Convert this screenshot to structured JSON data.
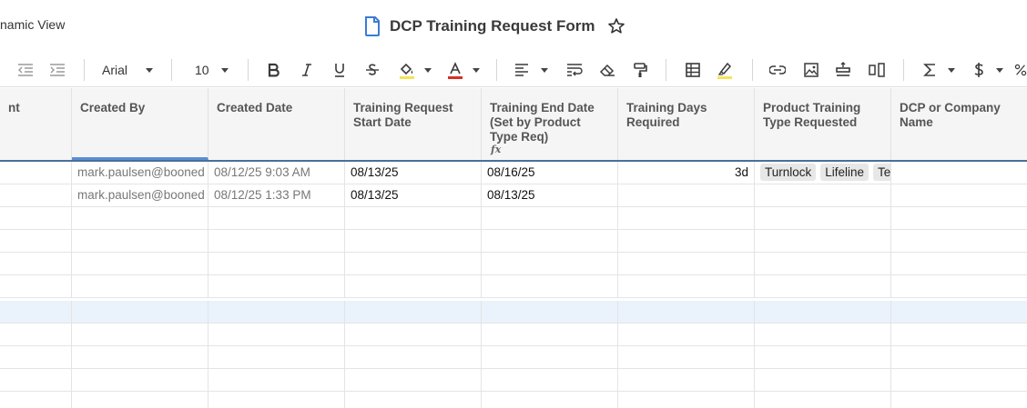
{
  "header": {
    "view_label": "namic View",
    "title": "DCP Training Request Form"
  },
  "toolbar": {
    "font_family": "Arial",
    "font_size": "10",
    "icons": [
      "outdent-icon",
      "indent-icon",
      "bold-icon",
      "italic-icon",
      "underline-icon",
      "strikethrough-icon",
      "fill-color-icon",
      "text-color-icon",
      "align-left-icon",
      "wrap-text-icon",
      "clear-format-icon",
      "paint-format-icon",
      "table-icon",
      "highlight-icon",
      "link-icon",
      "image-icon",
      "row-height-icon",
      "column-icon",
      "sum-icon",
      "currency-icon",
      "percent-icon"
    ],
    "fill_color_accent": "#f5e35a",
    "text_color_accent": "#d93025",
    "highlight_accent": "#f5e35a"
  },
  "grid": {
    "columns": [
      {
        "label": "nt"
      },
      {
        "label": "Created By"
      },
      {
        "label": "Created Date"
      },
      {
        "label": "Training Request Start Date"
      },
      {
        "label": "Training End Date (Set by Product Type Req)"
      },
      {
        "label": "Training Days Required"
      },
      {
        "label": "Product Training Type Requested"
      },
      {
        "label": "DCP or Company Name"
      }
    ],
    "rows": [
      {
        "created_by": "mark.paulsen@booned",
        "created_date": "08/12/25 9:03 AM",
        "start": "08/13/25",
        "end": "08/16/25",
        "days": "3d",
        "chips": [
          "Turnlock",
          "Lifeline",
          "Te"
        ]
      },
      {
        "created_by": "mark.paulsen@booned",
        "created_date": "08/12/25 1:33 PM",
        "start": "08/13/25",
        "end": "08/13/25",
        "days": "",
        "chips": []
      }
    ]
  }
}
